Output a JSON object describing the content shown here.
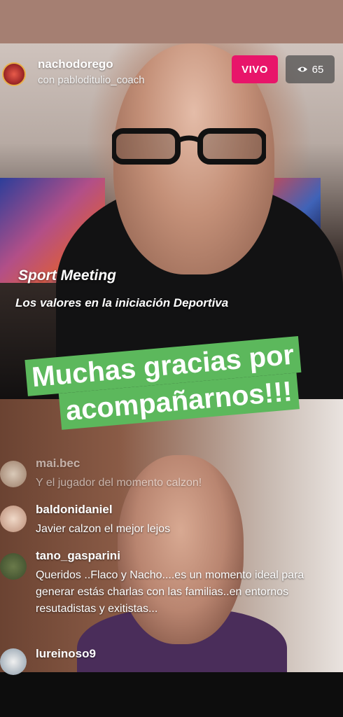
{
  "header": {
    "host_username": "nachodorego",
    "guest_line": "con pabloditulio_coach",
    "live_label": "VIVO",
    "viewer_count": "65"
  },
  "captions": {
    "title": "Sport Meeting",
    "subtitle": "Los valores en la iniciación Deportiva"
  },
  "banner": {
    "line1": "Muchas gracias por",
    "line2": "acompañarnos!!!"
  },
  "comments": [
    {
      "user": "mai.bec",
      "text": "Y el  jugador del momento calzon!"
    },
    {
      "user": "baldonidaniel",
      "text": "Javier calzon el mejor lejos"
    },
    {
      "user": "tano_gasparini",
      "text": "Queridos ..Flaco y Nacho....es un momento ideal para generar estás charlas con las familias..en entornos resutadistas y exitistas..."
    },
    {
      "user": "lureinoso9",
      "text": ""
    }
  ],
  "colors": {
    "live": "#e8156a",
    "banner": "#5cb85c"
  }
}
